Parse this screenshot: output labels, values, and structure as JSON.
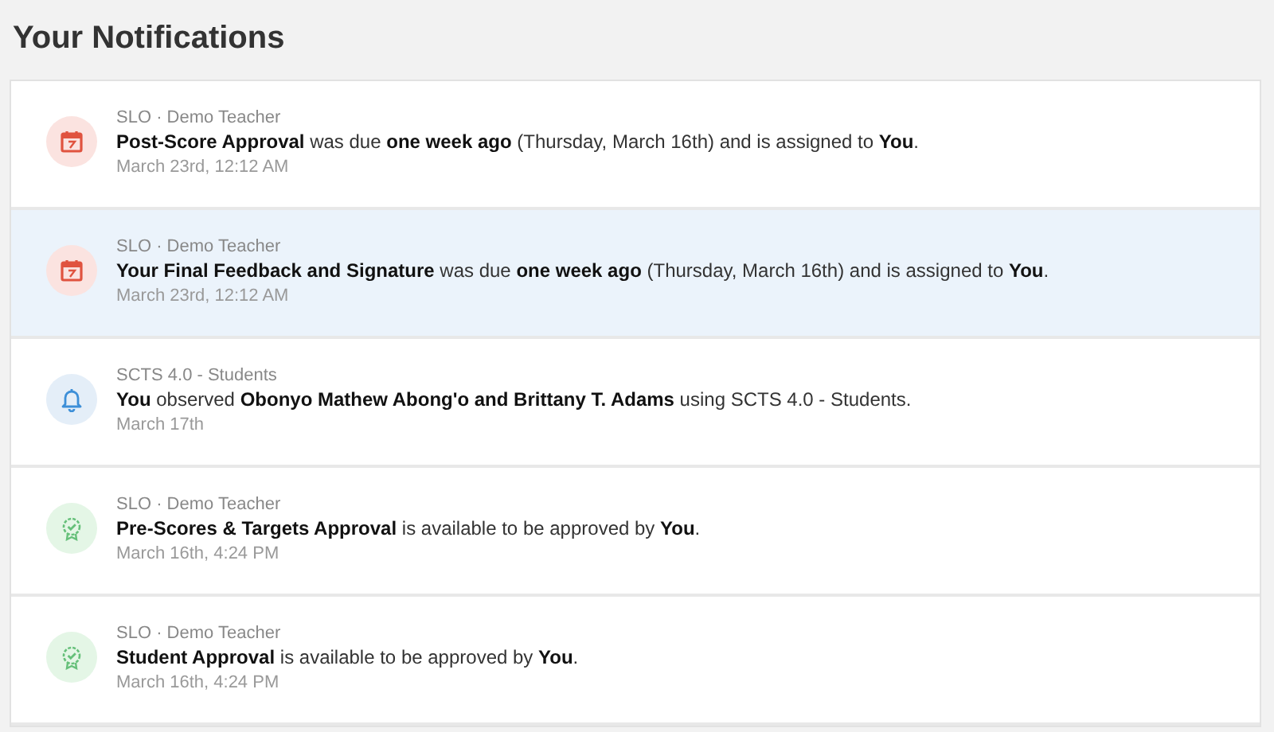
{
  "title": "Your Notifications",
  "notifications": [
    {
      "kind": "calendar",
      "highlighted": false,
      "source": "SLO · Demo Teacher",
      "message": "**Post-Score Approval** was due **one week ago** (Thursday, March 16th) and is assigned to **You**.",
      "time": "March 23rd, 12:12 AM"
    },
    {
      "kind": "calendar",
      "highlighted": true,
      "source": "SLO · Demo Teacher",
      "message": "**Your Final Feedback and Signature** was due **one week ago** (Thursday, March 16th) and is assigned to **You**.",
      "time": "March 23rd, 12:12 AM"
    },
    {
      "kind": "bell",
      "highlighted": false,
      "source": "SCTS 4.0 - Students",
      "message": "**You** observed **Obonyo Mathew Abong'o and Brittany T. Adams** using SCTS 4.0 - Students.",
      "time": "March 17th"
    },
    {
      "kind": "award",
      "highlighted": false,
      "source": "SLO · Demo Teacher",
      "message": "**Pre-Scores & Targets Approval** is available to be approved by **You**.",
      "time": "March 16th, 4:24 PM"
    },
    {
      "kind": "award",
      "highlighted": false,
      "source": "SLO · Demo Teacher",
      "message": "**Student Approval** is available to be approved by **You**.",
      "time": "March 16th, 4:24 PM"
    }
  ]
}
